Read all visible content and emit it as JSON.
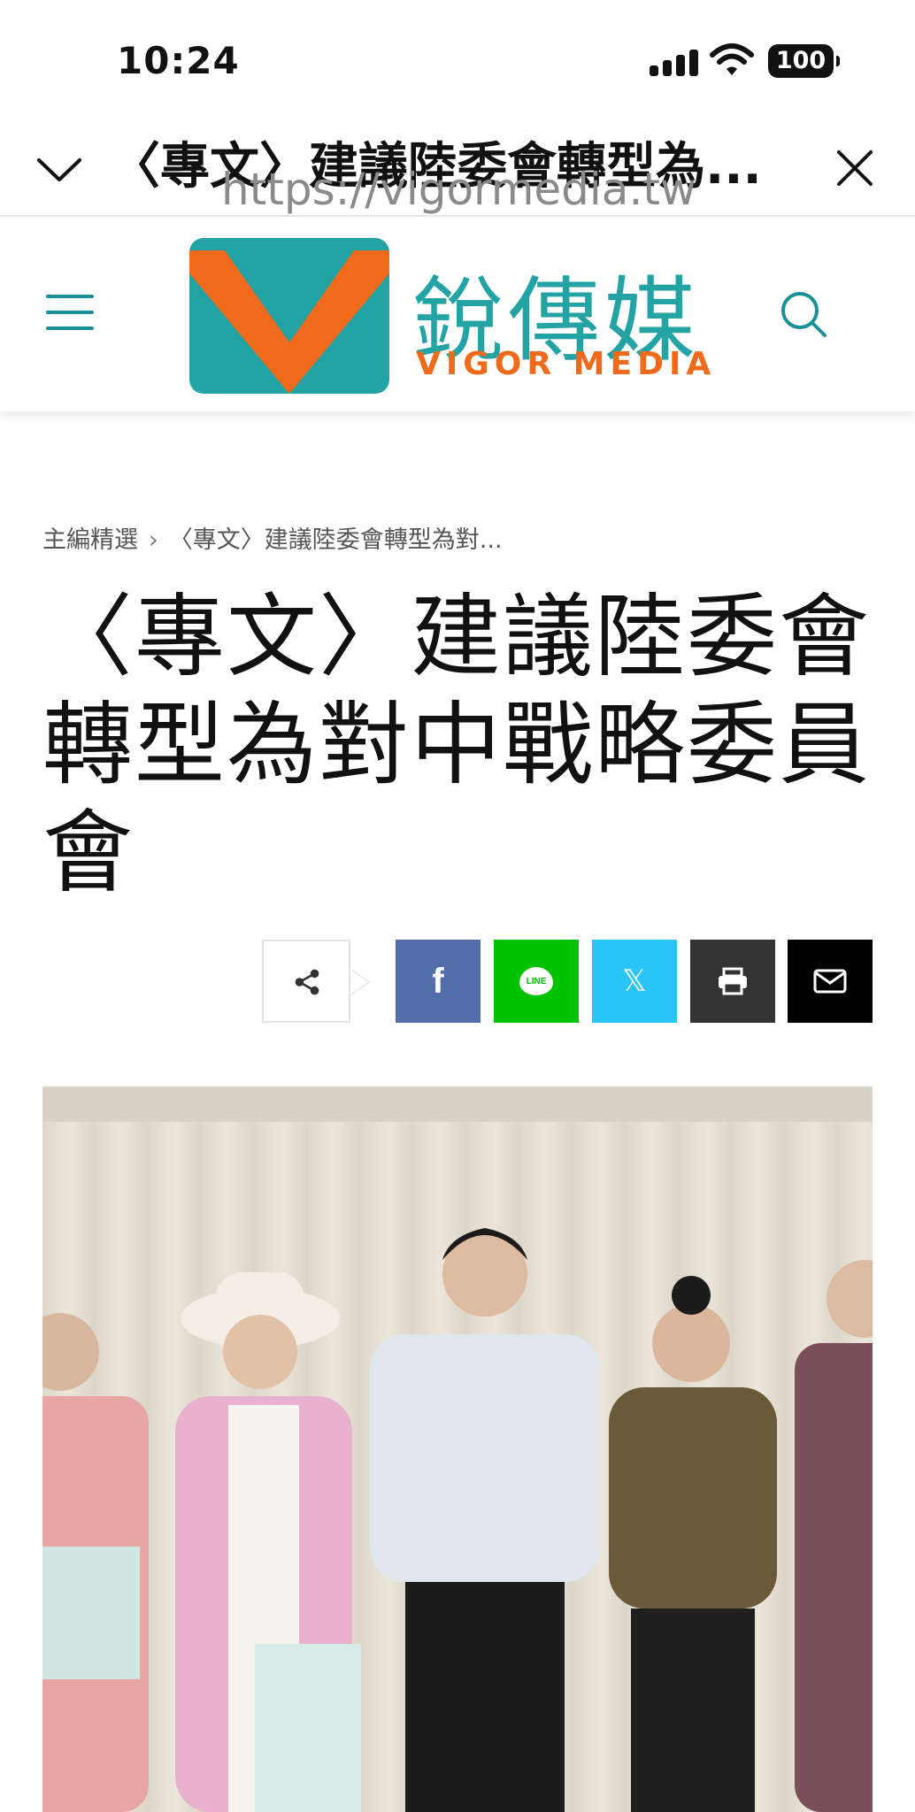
{
  "status_bar": {
    "time": "10:24",
    "battery": "100"
  },
  "browser": {
    "title": "〈專文〉建議陸委會轉型為...",
    "url": "https://vigormedia.tw"
  },
  "site": {
    "logo_cn": "銳傳媒",
    "logo_en": "VIGOR MEDIA",
    "colors": {
      "teal": "#23a3a3",
      "orange": "#ef6a1a"
    }
  },
  "breadcrumb": {
    "section": "主編精選",
    "separator": "›",
    "current": "〈專文〉建議陸委會轉型為對..."
  },
  "article": {
    "title": "〈專文〉建議陸委會轉型為對中戰略委員會"
  },
  "share": {
    "buttons": [
      {
        "icon": "share-icon"
      },
      {
        "icon": "facebook-icon",
        "color": "#516eab",
        "label": "f"
      },
      {
        "icon": "line-icon",
        "color": "#00c300",
        "label": "LINE"
      },
      {
        "icon": "x-icon",
        "color": "#29c5f6",
        "label": "𝕏"
      },
      {
        "icon": "print-icon",
        "color": "#333333"
      },
      {
        "icon": "mail-icon",
        "color": "#000000"
      }
    ]
  }
}
